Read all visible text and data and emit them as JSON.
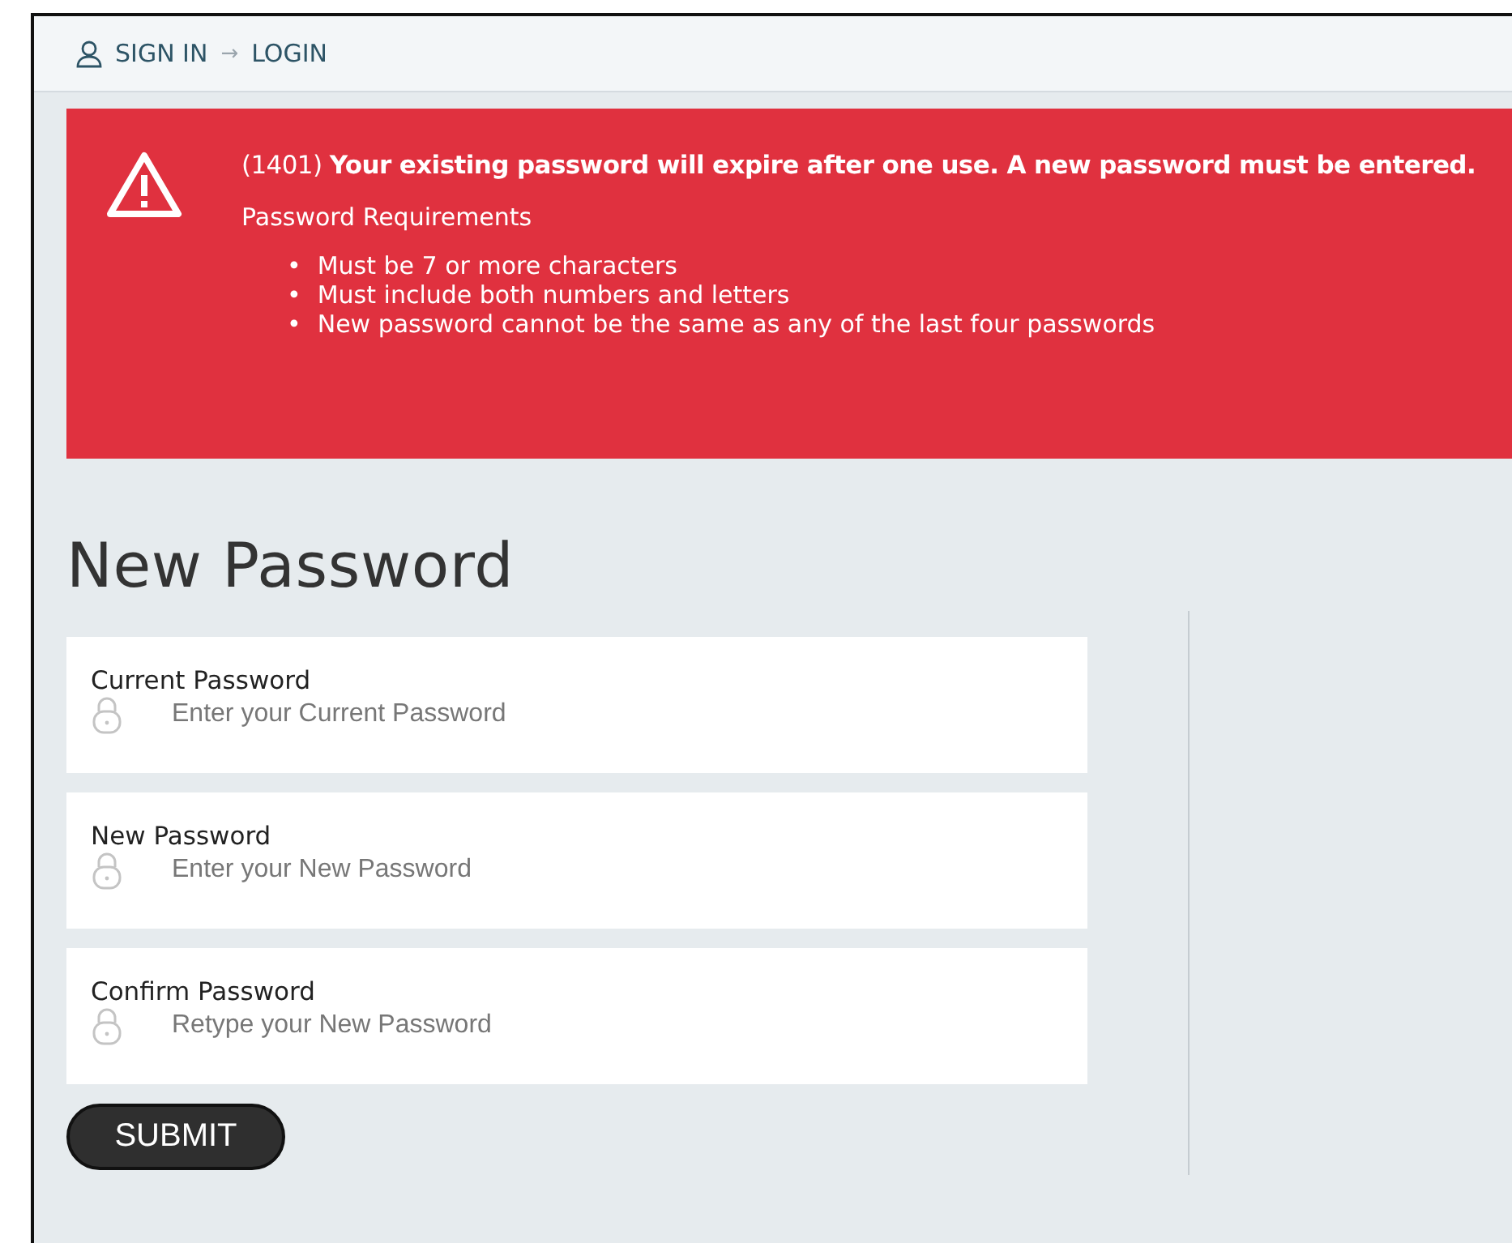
{
  "breadcrumb": {
    "items": [
      "SIGN IN",
      "LOGIN"
    ],
    "separator": "→"
  },
  "alert": {
    "message": "(1401) **Your existing password will expire after one use. A new password must be entered.**",
    "subtitle": "Password Requirements",
    "bullet": "•",
    "requirements": [
      "Must be 7 or more characters",
      "Must include both numbers and letters",
      "New password cannot be the same as any of the last four passwords"
    ]
  },
  "title": "New Password",
  "fields": [
    {
      "label": "Current Password",
      "placeholder": "Enter your Current Password"
    },
    {
      "label": "New Password",
      "placeholder": "Enter your New Password"
    },
    {
      "label": "Confirm Password",
      "placeholder": "Retype your New Password"
    }
  ],
  "submit": "SUBMIT"
}
